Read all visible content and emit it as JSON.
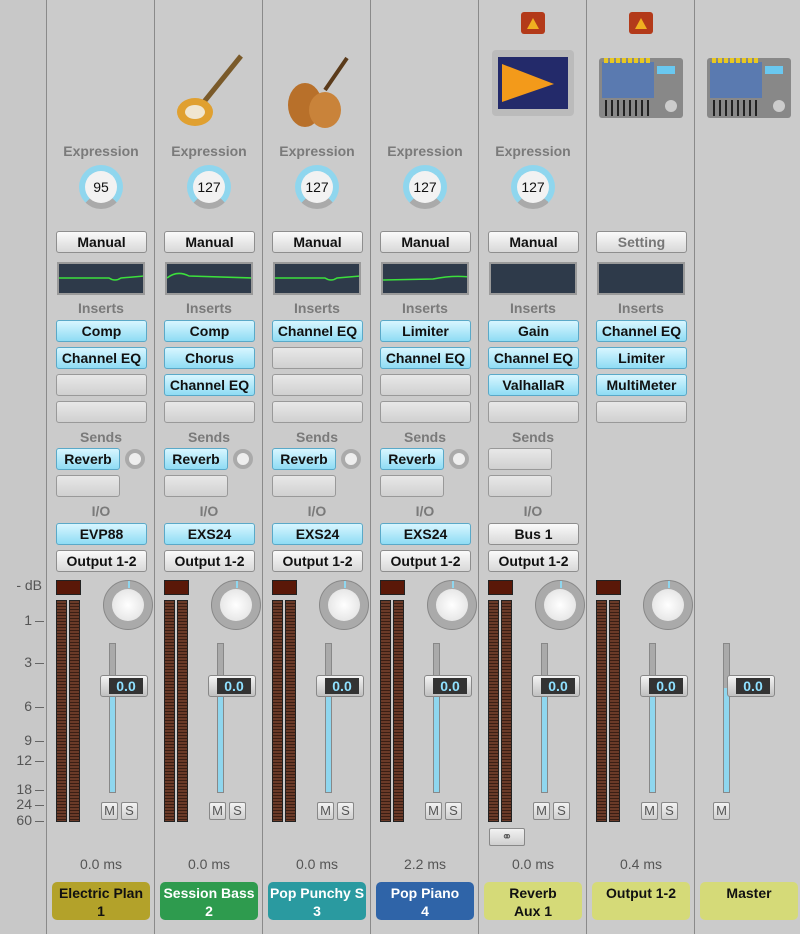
{
  "scale": {
    "unit": "- dB",
    "marks": [
      "1",
      "3",
      "6",
      "9",
      "12",
      "18",
      "24",
      "60"
    ]
  },
  "labels": {
    "expression": "Expression",
    "inserts": "Inserts",
    "sends": "Sends",
    "io": "I/O",
    "mute": "M",
    "solo": "S"
  },
  "strips": [
    {
      "icon": "electric-piano-icon",
      "expression": "95",
      "setting": "Manual",
      "eq_curve": "dip",
      "inserts": [
        "Comp",
        "Channel EQ",
        "",
        ""
      ],
      "sends": [
        "Reverb",
        ""
      ],
      "input": "EVP88",
      "output": "Output 1-2",
      "pan": "0",
      "volume": "0.0",
      "latency": "0.0 ms",
      "name": "Electric Plan",
      "number": "1",
      "color": "#b3a22a",
      "text_color": "#111"
    },
    {
      "icon": "bass-guitar-icon",
      "expression": "127",
      "setting": "Manual",
      "eq_curve": "bump",
      "inserts": [
        "Comp",
        "Chorus",
        "Channel EQ",
        ""
      ],
      "sends": [
        "Reverb",
        ""
      ],
      "input": "EXS24",
      "output": "Output 1-2",
      "pan": "0",
      "volume": "0.0",
      "latency": "0.0 ms",
      "name": "Session Bass",
      "number": "2",
      "color": "#2e9b4e",
      "text_color": "#fff"
    },
    {
      "icon": "strings-icon",
      "expression": "127",
      "setting": "Manual",
      "eq_curve": "dip",
      "inserts": [
        "Channel EQ",
        "",
        "",
        ""
      ],
      "sends": [
        "Reverb",
        ""
      ],
      "input": "EXS24",
      "output": "Output 1-2",
      "pan": "0",
      "volume": "0.0",
      "latency": "0.0 ms",
      "name": "Pop Punchy S",
      "number": "3",
      "color": "#2a9aa0",
      "text_color": "#fff"
    },
    {
      "icon": "piano-icon",
      "expression": "127",
      "setting": "Manual",
      "eq_curve": "rise",
      "inserts": [
        "Limiter",
        "Channel EQ",
        "",
        ""
      ],
      "sends": [
        "Reverb",
        ""
      ],
      "input": "EXS24",
      "output": "Output 1-2",
      "pan": "0",
      "volume": "0.0",
      "latency": "2.2 ms",
      "name": "Pop Piano",
      "number": "4",
      "color": "#2f64a8",
      "text_color": "#fff"
    },
    {
      "icon": "reverb-display-icon",
      "folder": true,
      "expression": "127",
      "setting": "Manual",
      "eq_curve": "flat",
      "inserts": [
        "Gain",
        "Channel EQ",
        "ValhallaR",
        ""
      ],
      "sends": [
        "",
        ""
      ],
      "input": "Bus 1",
      "output": "Output 1-2",
      "pan": "0",
      "volume": "0.0",
      "latency": "0.0 ms",
      "name": "Reverb",
      "number": "Aux 1",
      "color": "#d5da78",
      "text_color": "#111",
      "link": true
    },
    {
      "icon": "mixer-console-icon",
      "folder": true,
      "setting": "Setting",
      "eq_curve": "flat",
      "inserts": [
        "Channel EQ",
        "Limiter",
        "MultiMeter",
        ""
      ],
      "pan": "0",
      "volume": "0.0",
      "latency": "0.4 ms",
      "name": "Output 1-2",
      "number": "",
      "color": "#d5da78",
      "text_color": "#111"
    },
    {
      "icon": "mixer-console-icon",
      "master": true,
      "volume": "0.0",
      "name": "Master",
      "number": "",
      "color": "#d5da78",
      "text_color": "#111"
    }
  ]
}
